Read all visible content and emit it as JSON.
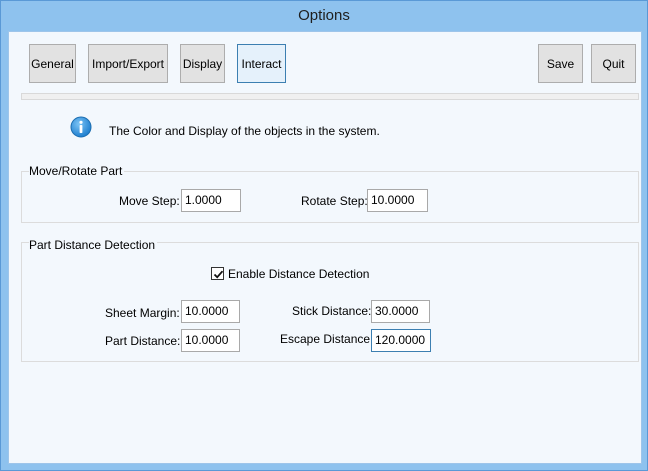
{
  "window": {
    "title": "Options"
  },
  "toolbar": {
    "general": "General",
    "import_export": "Import/Export",
    "display": "Display",
    "interact": "Interact",
    "save": "Save",
    "quit": "Quit",
    "active_tab": "Interact"
  },
  "info": {
    "icon": "info-icon",
    "text": "The Color and Display of the objects in the system."
  },
  "move_rotate": {
    "title": "Move/Rotate Part",
    "move_step_label": "Move Step:",
    "move_step_value": "1.0000",
    "rotate_step_label": "Rotate Step:",
    "rotate_step_value": "10.0000"
  },
  "distance": {
    "title": "Part Distance Detection",
    "enable_label": "Enable Distance Detection",
    "enable_checked": true,
    "sheet_margin_label": "Sheet Margin:",
    "sheet_margin_value": "10.0000",
    "part_distance_label": "Part Distance:",
    "part_distance_value": "10.0000",
    "stick_distance_label": "Stick Distance:",
    "stick_distance_value": "30.0000",
    "escape_distance_label": "Escape Distance:",
    "escape_distance_value": "120.0000"
  },
  "colors": {
    "title_bar": "#8ec2ee",
    "client": "#f3f8fd",
    "accent": "#3c7fb1",
    "info_icon": "#2a8fd8"
  }
}
